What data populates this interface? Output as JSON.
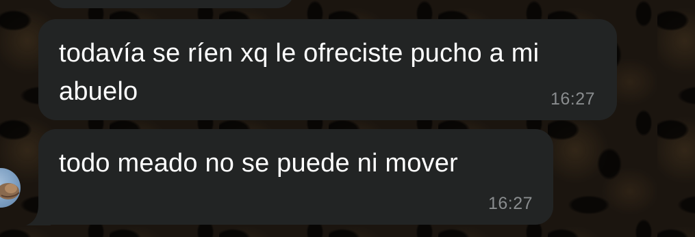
{
  "messages": [
    {
      "text": "",
      "time": ""
    },
    {
      "text": "todavía se ríen xq le ofreciste pucho a mi abuelo",
      "time": "16:27"
    },
    {
      "text": "todo meado no se puede ni mover",
      "time": "16:27"
    }
  ],
  "colors": {
    "bubble": "#222424",
    "text": "#ffffff",
    "time": "#8a8d8f",
    "avatar": "#7d9fc2"
  },
  "icons": {
    "avatar": "contact-avatar"
  }
}
